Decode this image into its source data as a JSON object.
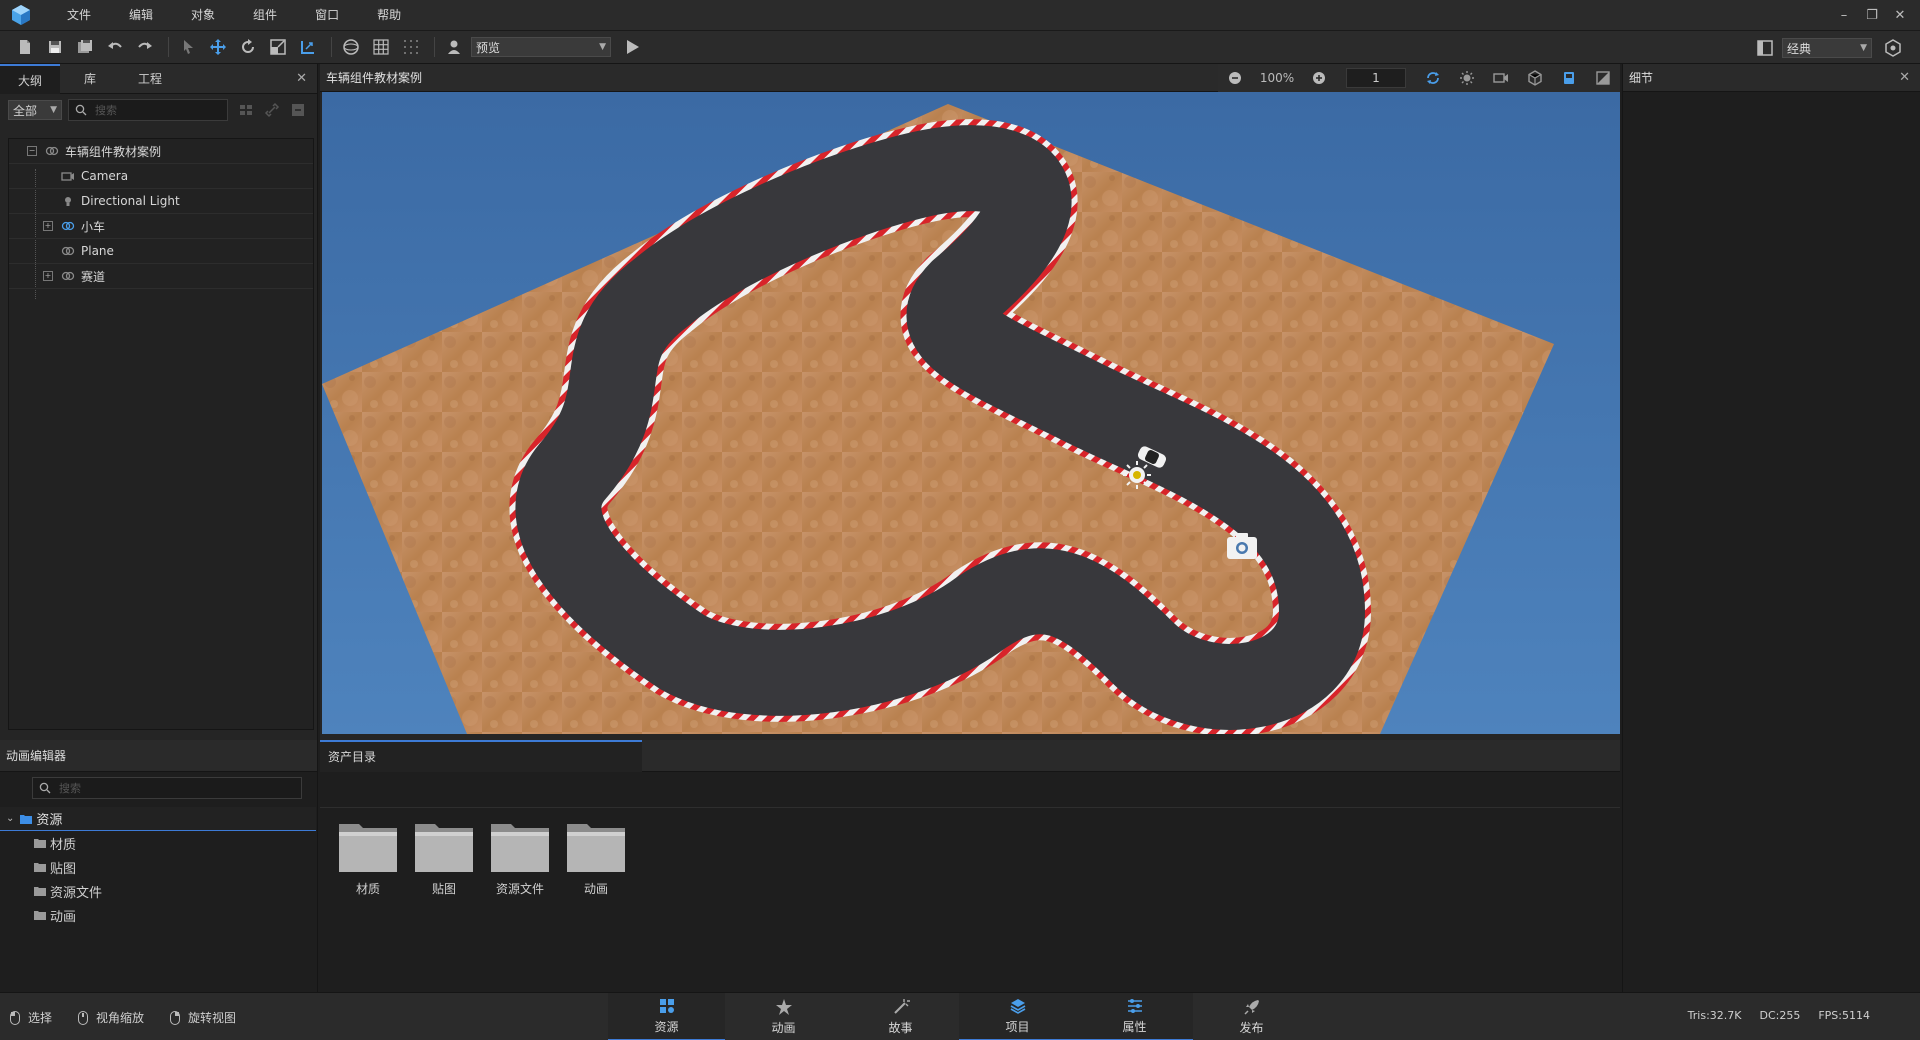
{
  "menu": [
    "文件",
    "编辑",
    "对象",
    "组件",
    "窗口",
    "帮助"
  ],
  "toolbar": {
    "mode_select": "预览",
    "layout_select": "经典"
  },
  "left_tabs": [
    "大纲",
    "库",
    "工程"
  ],
  "outline": {
    "scope": "全部",
    "search_placeholder": "搜索",
    "items": [
      {
        "label": "车辆组件教材案例",
        "icon": "group-icon",
        "expandable": true
      },
      {
        "label": "Camera",
        "icon": "camera-icon"
      },
      {
        "label": "Directional Light",
        "icon": "light-icon"
      },
      {
        "label": "小车",
        "icon": "group-icon",
        "expandable": true
      },
      {
        "label": "Plane",
        "icon": "group-icon"
      },
      {
        "label": "赛道",
        "icon": "group-icon",
        "expandable": true
      }
    ]
  },
  "viewport": {
    "title": "车辆组件教材案例",
    "zoom": "100%",
    "frame": "1"
  },
  "details": {
    "title": "细节"
  },
  "anim_editor": {
    "title": "动画编辑器",
    "search_placeholder": "搜索",
    "root": "资源",
    "children": [
      "材质",
      "贴图",
      "资源文件",
      "动画"
    ]
  },
  "assets": {
    "tab": "资产目录",
    "folders": [
      "材质",
      "贴图",
      "资源文件",
      "动画"
    ]
  },
  "status": {
    "hints": [
      "选择",
      "视角缩放",
      "旋转视图"
    ],
    "nav": [
      "资源",
      "动画",
      "故事",
      "项目",
      "属性",
      "发布"
    ],
    "tris": "Tris:32.7K",
    "dc": "DC:255",
    "fps": "FPS:5114"
  },
  "colors": {
    "accent": "#3d7bd6",
    "sky": "#3f6fa8",
    "ground": "#c28a5a",
    "track": "#3a3a3e"
  }
}
